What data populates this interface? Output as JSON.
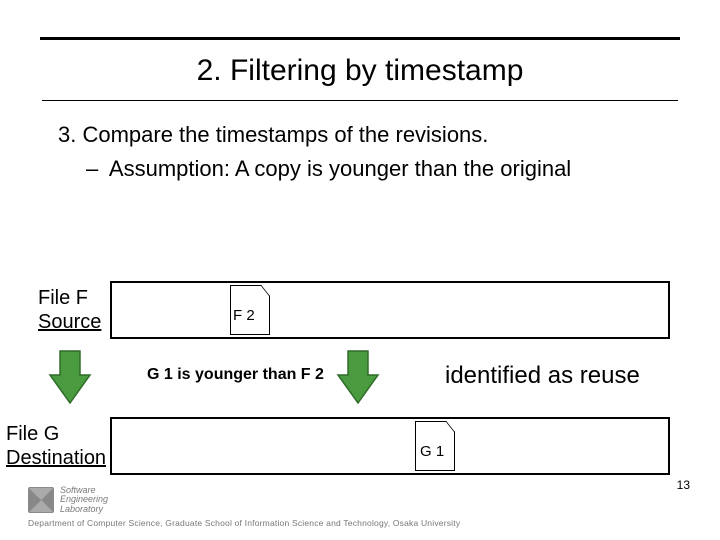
{
  "title": "2. Filtering by timestamp",
  "body": {
    "line1": "3.   Compare the timestamps of the revisions.",
    "line2_dash": "–",
    "line2_text": "Assumption: A copy is younger than the original"
  },
  "labels": {
    "fileF_name": "File F",
    "fileF_role": "Source",
    "fileG_name": "File G",
    "fileG_role": "Destination"
  },
  "icons": {
    "f2": "F 2",
    "g1": "G 1"
  },
  "middle": {
    "younger": "G 1 is younger than F 2",
    "reuse": "identified as reuse"
  },
  "logo": {
    "line1": "Software",
    "line2": "Engineering",
    "line3": "Laboratory"
  },
  "footer": "Department of Computer Science, Graduate School of Information Science and Technology, Osaka University",
  "slide_number": "13"
}
